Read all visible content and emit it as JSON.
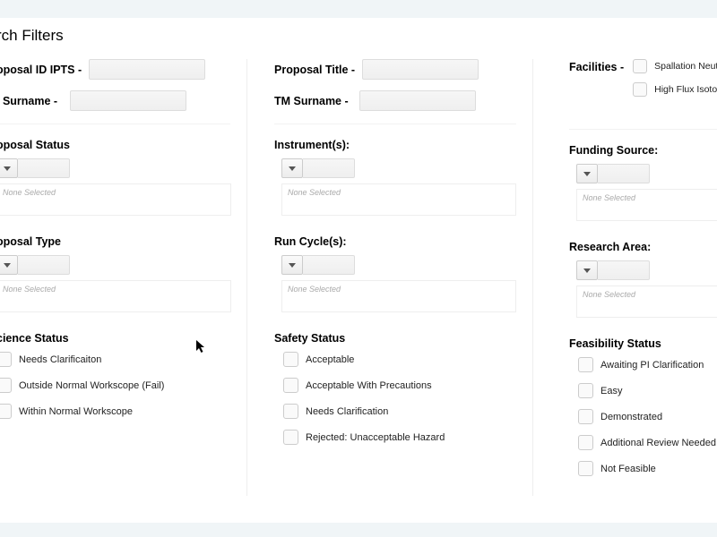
{
  "title": "rch Filters",
  "row1": {
    "proposalId": {
      "label": "oposal ID IPTS -"
    },
    "proposalTitle": {
      "label": "Proposal Title -"
    },
    "facilities": {
      "label": "Facilities -",
      "opts": [
        "Spallation Neutron",
        "High Flux Isotope"
      ]
    }
  },
  "row2": {
    "piSurname": {
      "label": "I Surname -"
    },
    "tmSurname": {
      "label": "TM Surname -"
    }
  },
  "placeholders": {
    "none": "None Selected"
  },
  "sections": {
    "proposalStatus": "oposal Status",
    "instruments": "Instrument(s):",
    "fundingSource": "Funding Source:",
    "proposalType": "oposal Type",
    "runCycles": "Run Cycle(s):",
    "researchArea": "Research Area:",
    "scienceStatus": "cience Status",
    "safetyStatus": "Safety Status",
    "feasibilityStatus": "Feasibility Status"
  },
  "scienceOpts": [
    "Needs Clarificaiton",
    "Outside Normal Workscope (Fail)",
    "Within Normal Workscope"
  ],
  "safetyOpts": [
    "Acceptable",
    "Acceptable With Precautions",
    "Needs Clarification",
    "Rejected: Unacceptable Hazard"
  ],
  "feasOpts": [
    "Awaiting PI Clarification",
    "Easy",
    "Demonstrated",
    "Additional Review Needed",
    "Not Feasible"
  ]
}
